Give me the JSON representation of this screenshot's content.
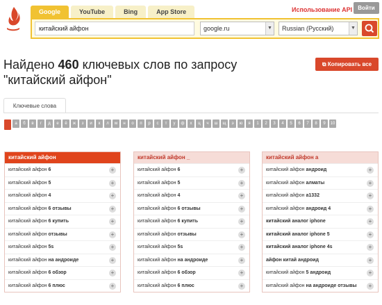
{
  "header": {
    "tabs": [
      "Google",
      "YouTube",
      "Bing",
      "App Store"
    ],
    "api_link": "Использование API",
    "login": "Войти"
  },
  "search": {
    "query": "китайский айфон",
    "engine": "google.ru",
    "language": "Russian (Русский)"
  },
  "result": {
    "prefix": "Найдено",
    "count": "460",
    "suffix": "ключевых слов по запросу",
    "query_quoted": "\"китайский айфон\"",
    "copy_all": "Копировать все"
  },
  "keywords_tab": "Ключевые слова",
  "letters": [
    "",
    "а",
    "б",
    "в",
    "г",
    "д",
    "е",
    "ё",
    "ж",
    "з",
    "и",
    "к",
    "л",
    "м",
    "н",
    "о",
    "п",
    "р",
    "с",
    "т",
    "у",
    "ф",
    "х",
    "ц",
    "ч",
    "ш",
    "щ",
    "э",
    "ю",
    "я",
    "1",
    "2",
    "3",
    "4",
    "5",
    "6",
    "7",
    "8",
    "9",
    "10"
  ],
  "columns": [
    {
      "head": "китайский айфон",
      "rows": [
        [
          "китайский айфон ",
          "6"
        ],
        [
          "китайский айфон ",
          "5"
        ],
        [
          "китайский айфон ",
          "4"
        ],
        [
          "китайский айфон ",
          "6 отзывы"
        ],
        [
          "китайский айфон ",
          "6 купить"
        ],
        [
          "китайский айфон ",
          "отзывы"
        ],
        [
          "китайский айфон ",
          "5s"
        ],
        [
          "китайский айфон ",
          "на андроиде"
        ],
        [
          "китайский айфон ",
          "6 обзор"
        ],
        [
          "китайский айфон ",
          "6 плюс"
        ]
      ]
    },
    {
      "head": "китайский айфон _",
      "rows": [
        [
          "китайский айфон ",
          "6"
        ],
        [
          "китайский айфон ",
          "5"
        ],
        [
          "китайский айфон ",
          "4"
        ],
        [
          "китайский айфон ",
          "6 отзывы"
        ],
        [
          "китайский айфон ",
          "6 купить"
        ],
        [
          "китайский айфон ",
          "отзывы"
        ],
        [
          "китайский айфон ",
          "5s"
        ],
        [
          "китайский айфон ",
          "на андроиде"
        ],
        [
          "китайский айфон ",
          "6 обзор"
        ],
        [
          "китайский айфон ",
          "6 плюс"
        ]
      ]
    },
    {
      "head": "китайский айфон а",
      "rows": [
        [
          "китайский айфон ",
          "андроид"
        ],
        [
          "китайский айфон ",
          "алматы"
        ],
        [
          "китайский айфон ",
          "а1332"
        ],
        [
          "китайский айфон ",
          "андроид 4"
        ],
        [
          "",
          "китайский аналог iphone"
        ],
        [
          "",
          "китайский аналог iphone 5"
        ],
        [
          "",
          "китайский аналог iphone 4s"
        ],
        [
          "",
          "айфон китай андроид"
        ],
        [
          "китайский айфон ",
          "5 андроид"
        ],
        [
          "китайский айфон ",
          "на андроиде отзывы"
        ]
      ]
    }
  ]
}
